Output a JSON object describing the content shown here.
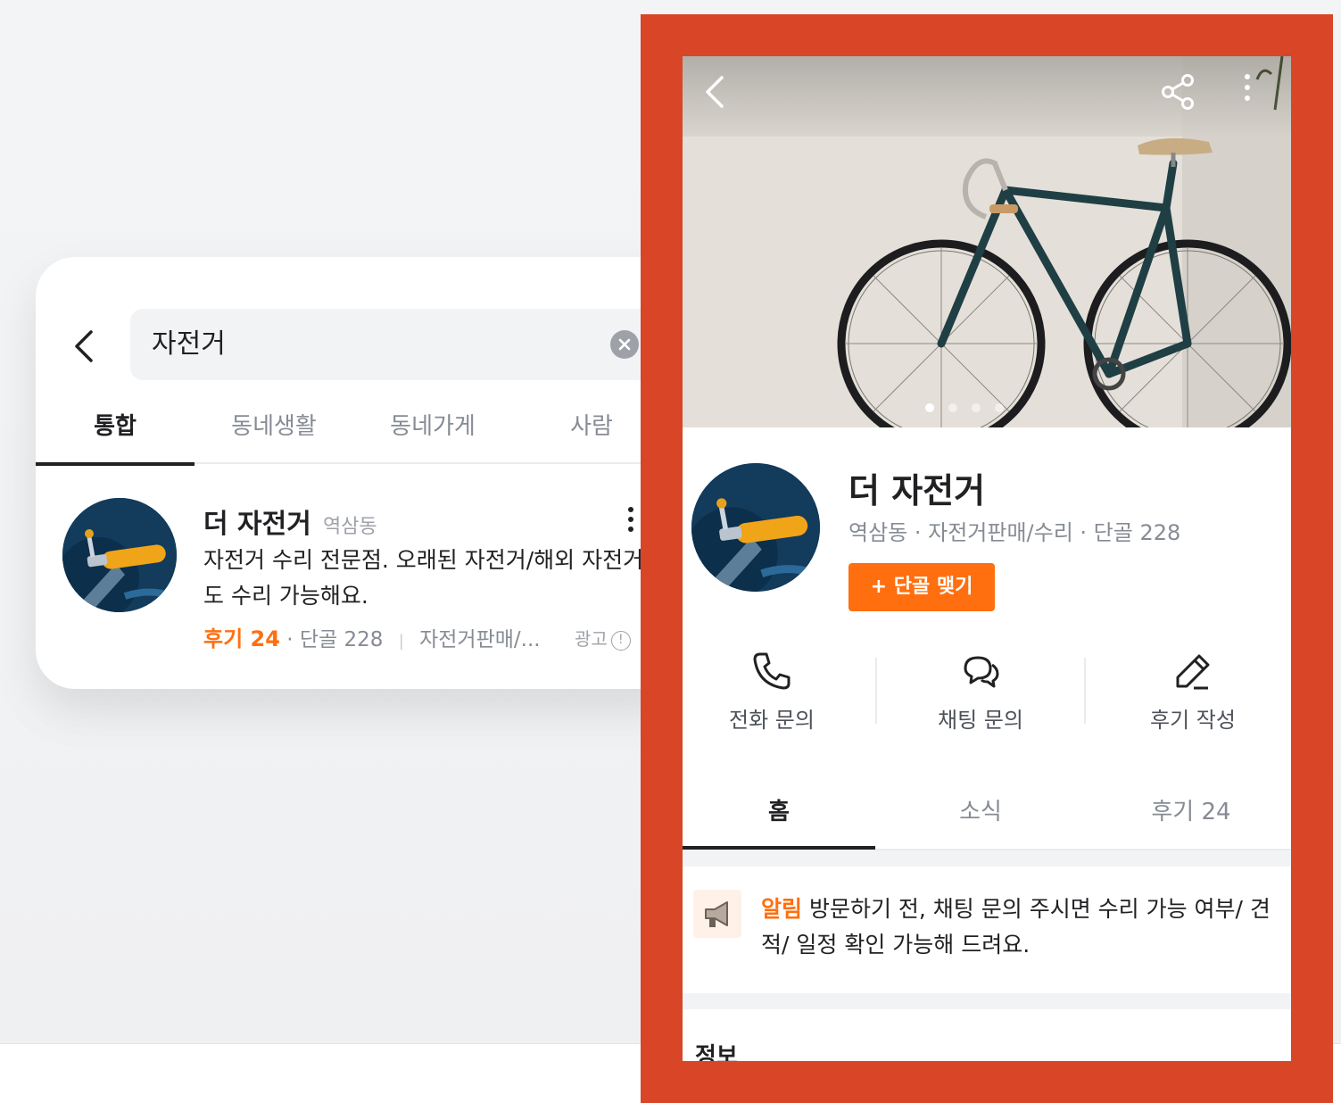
{
  "search_screen": {
    "query": "자전거",
    "tabs": [
      {
        "label": "통합",
        "active": true
      },
      {
        "label": "동네생활",
        "active": false
      },
      {
        "label": "동네가게",
        "active": false
      },
      {
        "label": "사람",
        "active": false
      }
    ],
    "result": {
      "name": "더 자전거",
      "location": "역삼동",
      "description": "자전거 수리 전문점. 오래된 자전거/해외 자전거도 수리 가능해요.",
      "review_label": "후기 24",
      "regulars": "· 단골 228",
      "category": "자전거판매/...",
      "ad_label": "광고",
      "ad_info_glyph": "!"
    }
  },
  "store_screen": {
    "carousel_dots": 4,
    "active_dot": 0,
    "name": "더 자전거",
    "meta": "역삼동 · 자전거판매/수리 · 단골 228",
    "follow_button": "+ 단골 맺기",
    "actions": [
      {
        "label": "전화 문의",
        "icon": "phone-icon"
      },
      {
        "label": "채팅 문의",
        "icon": "chat-icon"
      },
      {
        "label": "후기 작성",
        "icon": "pencil-icon"
      }
    ],
    "tabs": [
      {
        "label": "홈",
        "active": true
      },
      {
        "label": "소식",
        "active": false
      },
      {
        "label": "후기 24",
        "active": false
      }
    ],
    "notice": {
      "label": "알림",
      "text": " 방문하기 전, 채팅 문의 주시면 수리 가능 여부/ 견적/ 일정 확인 가능해 드려요."
    },
    "next_section_title": "정보"
  },
  "colors": {
    "accent_orange": "#ff6f0f",
    "highlight_frame": "#d94527",
    "text_primary": "#212124",
    "text_secondary": "#868b94"
  }
}
